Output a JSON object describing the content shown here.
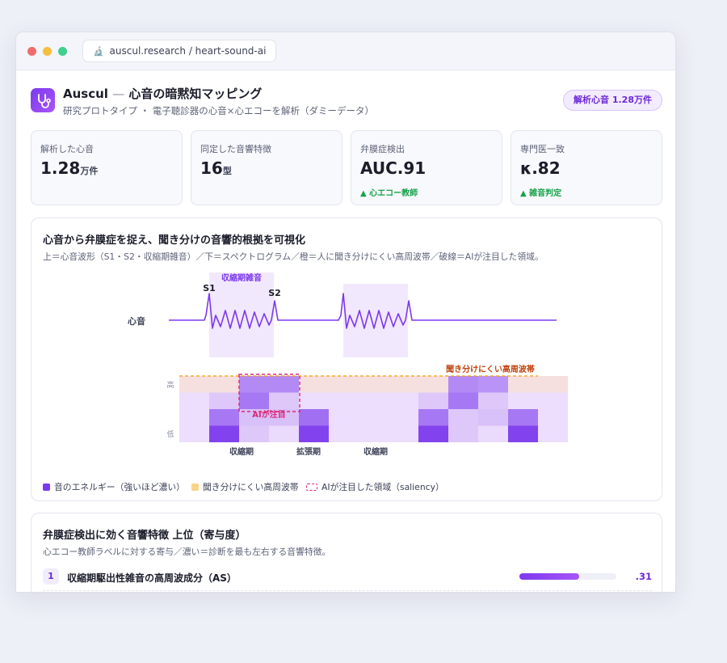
{
  "browser": {
    "url": "auscul.research / heart-sound-ai",
    "url_icon": "🔬"
  },
  "header": {
    "app_name": "Auscul",
    "dash": "—",
    "app_title": "心音の暗黙知マッピング",
    "subtitle": "研究プロトタイプ ・ 電子聴診器の心音×心エコーを解析（ダミーデータ）",
    "badge": "解析心音 1.28万件",
    "logo_icon": "stethoscope-icon"
  },
  "stats": [
    {
      "label": "解析した心音",
      "value": "1.28",
      "unit": "万件",
      "delta": ""
    },
    {
      "label": "同定した音響特徴",
      "value": "16",
      "unit": "型",
      "delta": ""
    },
    {
      "label": "弁膜症検出",
      "value": "AUC.91",
      "unit": "",
      "delta": "▲ 心エコー教師"
    },
    {
      "label": "専門医一致",
      "value": "κ.82",
      "unit": "",
      "delta": "▲ 雑音判定"
    }
  ],
  "viz": {
    "title": "心音から弁膜症を捉え、聞き分けの音響的根拠を可視化",
    "subtitle": "上＝心音波形（S1・S2・収縮期雑音）／下＝スペクトログラム／橙＝人に聞き分けにくい高周波帯／破線＝AIが注目した領域。",
    "wave_label": "心音",
    "s1_label": "S1",
    "s2_label": "S2",
    "murmur_label": "収縮期雑音",
    "freq_high": "高",
    "freq_low": "低",
    "band_label": "聞き分けにくい高周波帯",
    "attention_label": "AIが注目",
    "phase_labels": [
      "収縮期",
      "拡張期",
      "収縮期"
    ],
    "colors": {
      "accent": "#7c3aed",
      "band": "#f59e0b",
      "attention": "#db2777"
    },
    "spectrogram": [
      [
        0.1,
        0.1,
        0.55,
        0.55,
        0.1,
        0.1,
        0.1,
        0.1,
        0.1,
        0.55,
        0.5,
        0.1,
        0.1
      ],
      [
        0.08,
        0.2,
        0.65,
        0.2,
        0.08,
        0.08,
        0.08,
        0.08,
        0.2,
        0.65,
        0.2,
        0.08,
        0.08
      ],
      [
        0.08,
        0.65,
        0.25,
        0.25,
        0.7,
        0.08,
        0.08,
        0.08,
        0.65,
        0.2,
        0.25,
        0.65,
        0.08
      ],
      [
        0.08,
        0.95,
        0.2,
        0.1,
        0.95,
        0.08,
        0.08,
        0.08,
        0.95,
        0.2,
        0.1,
        0.95,
        0.08
      ]
    ]
  },
  "legend": {
    "energy": "音のエネルギー（強いほど濃い）",
    "band": "聞き分けにくい高周波帯",
    "attention": "AIが注目した領域（saliency）"
  },
  "features": {
    "title": "弁膜症検出に効く音響特徴 上位（寄与度）",
    "subtitle": "心エコー教師ラベルに対する寄与／濃い＝診断を最も左右する音響特徴。",
    "items": [
      {
        "rank": "1",
        "label": "収縮期駆出性雑音の高周波成分（AS）",
        "value": ".31",
        "score": 0.62
      }
    ]
  }
}
